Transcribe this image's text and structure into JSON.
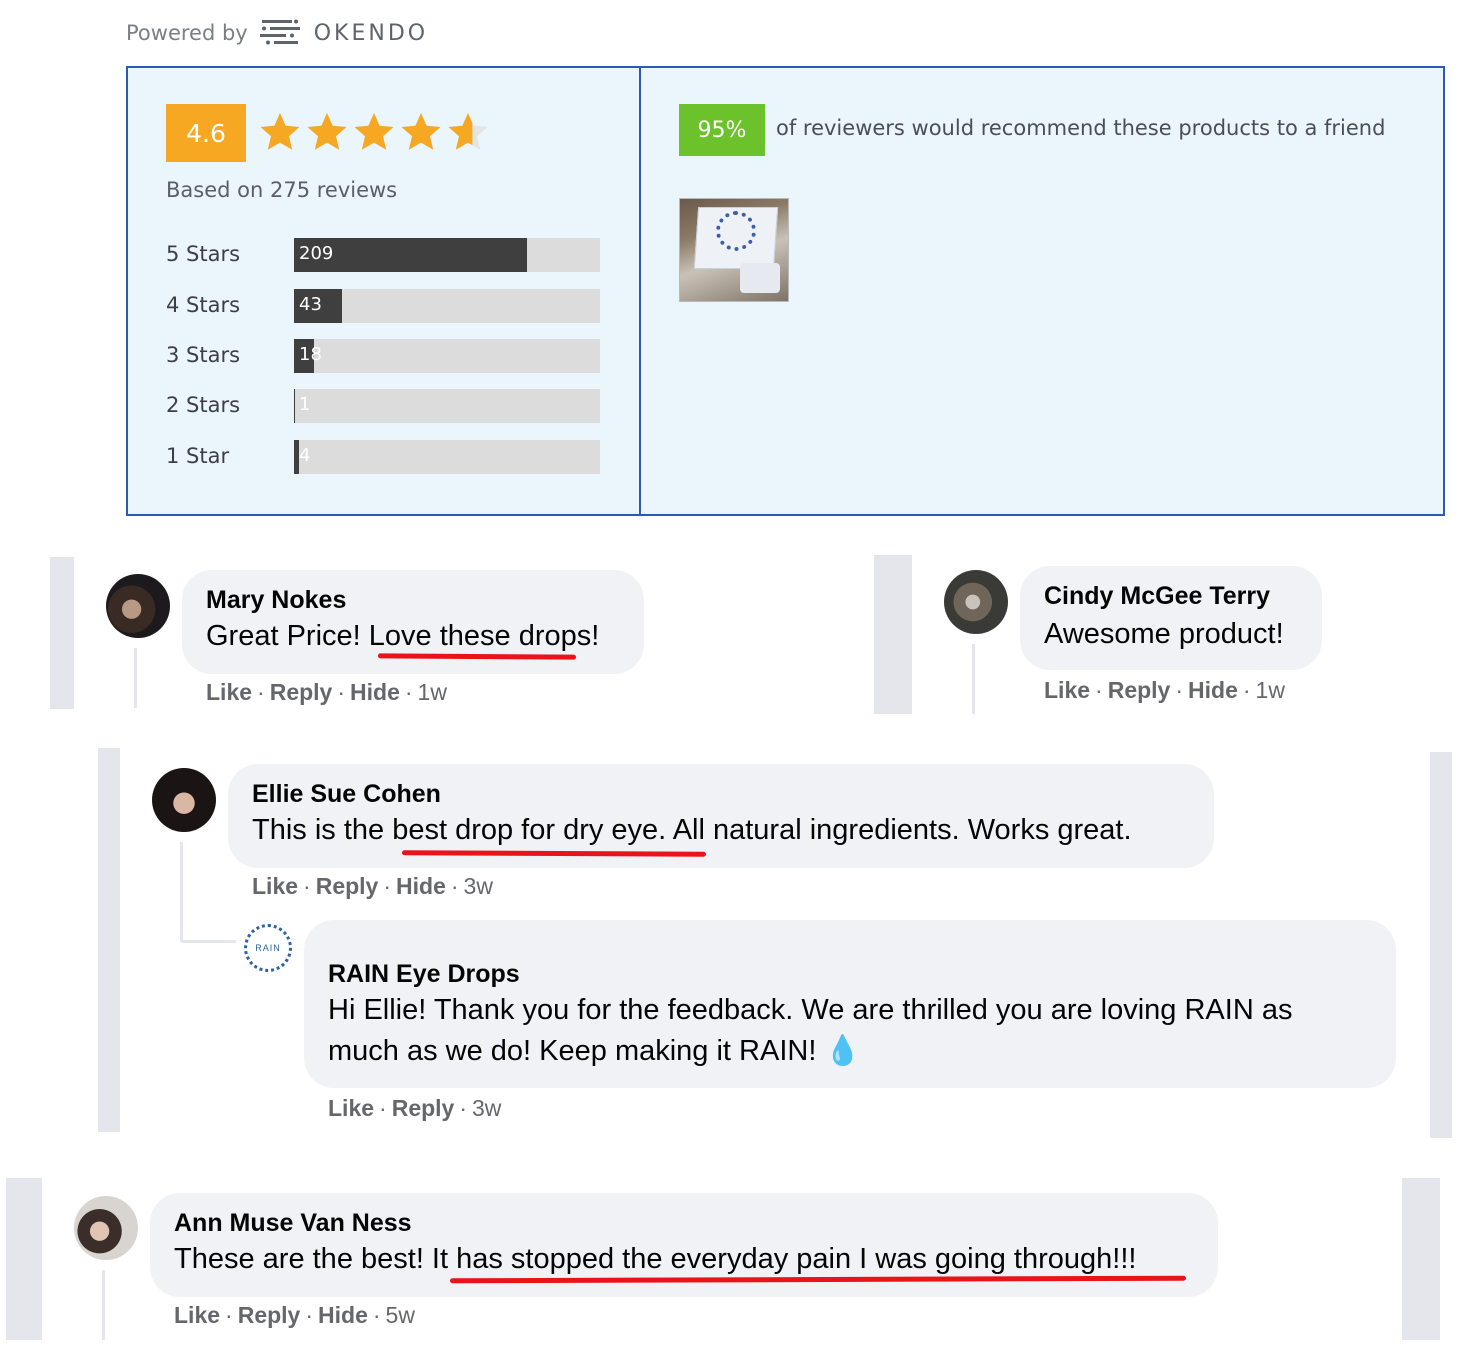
{
  "powered": {
    "prefix": "Powered by",
    "brand": "OKENDO",
    "icon": "okendo-logo-icon"
  },
  "summary": {
    "average": "4.6",
    "stars_rating": 4.6,
    "based_on": "Based on 275 reviews",
    "distribution": [
      {
        "label": "5 Stars",
        "count": "209",
        "fraction": 0.76
      },
      {
        "label": "4 Stars",
        "count": "43",
        "fraction": 0.156
      },
      {
        "label": "3 Stars",
        "count": "18",
        "fraction": 0.065
      },
      {
        "label": "2 Stars",
        "count": "1",
        "fraction": 0.004
      },
      {
        "label": "1 Star",
        "count": "4",
        "fraction": 0.015
      }
    ],
    "recommend_percent": "95%",
    "recommend_text": "of reviewers would recommend these products to a friend",
    "colors": {
      "score_badge": "#f7a823",
      "recommend_badge": "#6cc22a",
      "border": "#2d58b4",
      "panel_bg": "#eaf5fc"
    }
  },
  "comments": [
    {
      "name": "Mary Nokes",
      "text": "Great Price! Love these drops!",
      "actions": {
        "like": "Like",
        "reply": "Reply",
        "hide": "Hide",
        "time": "1w"
      }
    },
    {
      "name": "Cindy McGee Terry",
      "text": "Awesome product!",
      "actions": {
        "like": "Like",
        "reply": "Reply",
        "hide": "Hide",
        "time": "1w"
      }
    },
    {
      "name": "Ellie Sue Cohen",
      "text": "This is the best drop for dry eye. All natural ingredients. Works great.",
      "actions": {
        "like": "Like",
        "reply": "Reply",
        "hide": "Hide",
        "time": "3w"
      }
    },
    {
      "name": "RAIN Eye Drops",
      "text_line1": "Hi Ellie! Thank you for the feedback. We are thrilled you are loving RAIN as",
      "text_line2": "much as we do! Keep making it RAIN! 💧",
      "avatar_text": "RAIN",
      "actions": {
        "like": "Like",
        "reply": "Reply",
        "time": "3w"
      }
    },
    {
      "name": "Ann Muse Van Ness",
      "text": "These are the best! It has stopped the everyday pain I was going through!!!",
      "actions": {
        "like": "Like",
        "reply": "Reply",
        "hide": "Hide",
        "time": "5w"
      }
    }
  ],
  "highlight_color": "#e8141a"
}
